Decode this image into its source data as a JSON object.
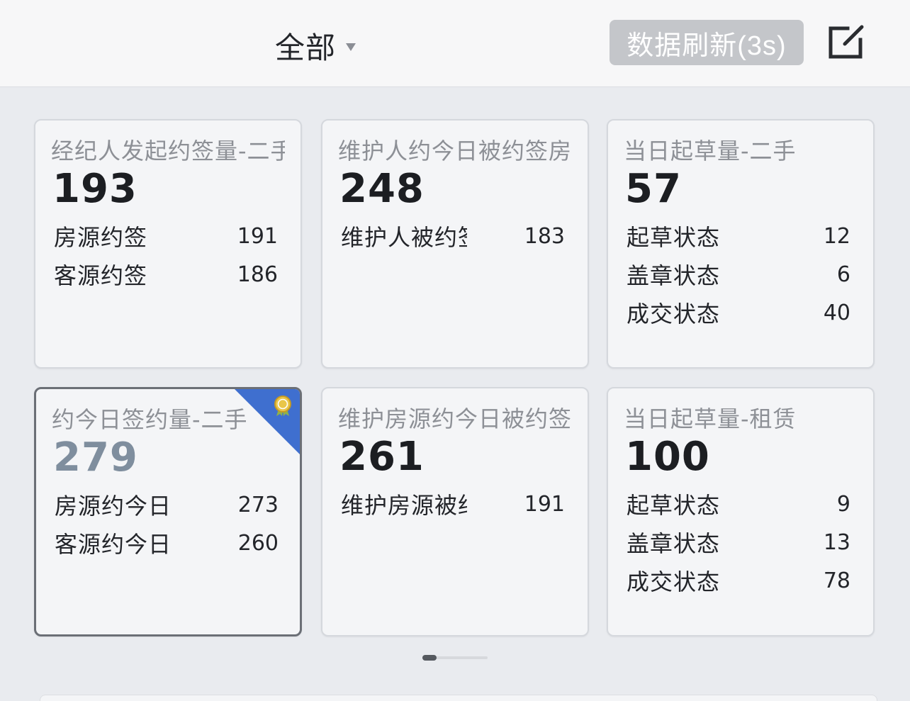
{
  "header": {
    "filter_label": "全部",
    "refresh_label": "数据刷新(3s)"
  },
  "cards": [
    {
      "title": "经纪人发起约签量-二手",
      "total": "193",
      "rows": [
        {
          "label": "房源约签",
          "value": "191"
        },
        {
          "label": "客源约签",
          "value": "186"
        }
      ]
    },
    {
      "title": "维护人约今日被约签房",
      "total": "248",
      "rows": [
        {
          "label": "维护人被约签",
          "value": "183"
        }
      ]
    },
    {
      "title": "当日起草量-二手",
      "total": "57",
      "rows": [
        {
          "label": "起草状态",
          "value": "12"
        },
        {
          "label": "盖章状态",
          "value": "6"
        },
        {
          "label": "成交状态",
          "value": "40"
        }
      ]
    },
    {
      "title": "约今日签约量-二手",
      "total": "279",
      "rows": [
        {
          "label": "房源约今日",
          "value": "273"
        },
        {
          "label": "客源约今日",
          "value": "260"
        }
      ]
    },
    {
      "title": "维护房源约今日被约签",
      "total": "261",
      "rows": [
        {
          "label": "维护房源被约",
          "value": "191"
        }
      ]
    },
    {
      "title": "当日起草量-租赁",
      "total": "100",
      "rows": [
        {
          "label": "起草状态",
          "value": "9"
        },
        {
          "label": "盖章状态",
          "value": "13"
        },
        {
          "label": "成交状态",
          "value": "78"
        }
      ]
    }
  ],
  "icons": {
    "filter": "caret-down-icon",
    "edit": "edit-square-icon",
    "badge": "medal-icon"
  },
  "colors": {
    "badge": "#3f6fcf",
    "refresh_bg": "#c4c6ca"
  },
  "pager": {
    "current_page": 1
  }
}
